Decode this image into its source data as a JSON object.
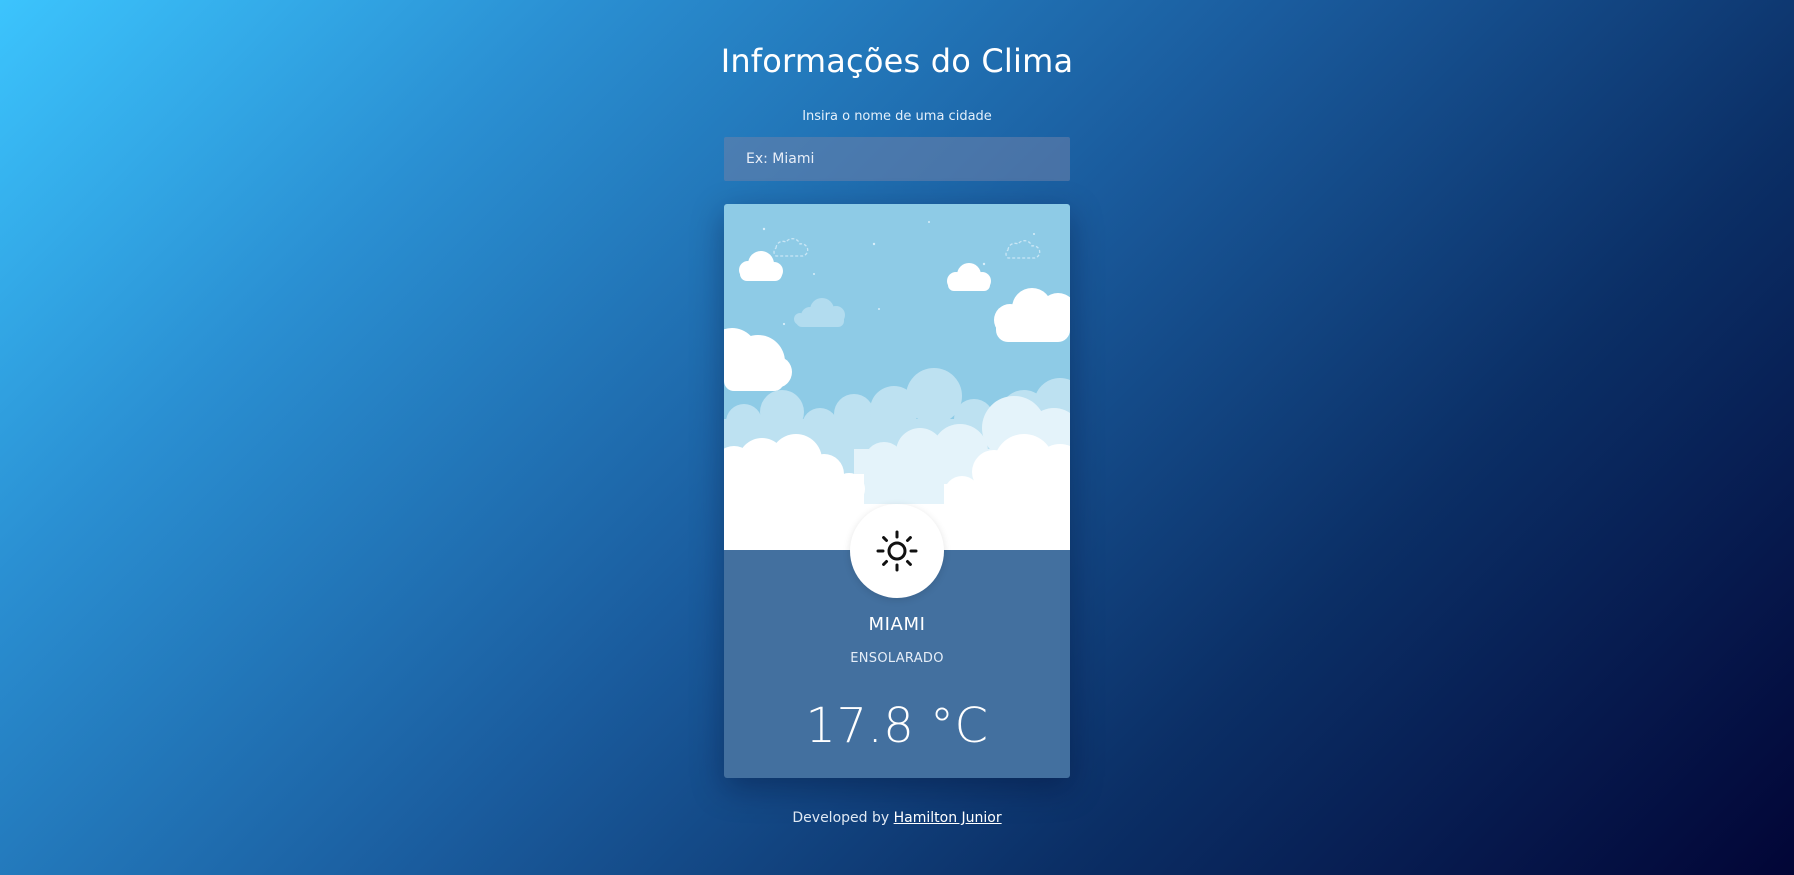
{
  "header": {
    "title": "Informações do Clima"
  },
  "search": {
    "label": "Insira o nome de uma cidade",
    "placeholder": "Ex: Miami",
    "value": ""
  },
  "weather": {
    "city": "MIAMI",
    "condition": "ENSOLARADO",
    "temperature": "17.8 °C",
    "icon": "sun-icon"
  },
  "footer": {
    "prefix": "Developed by",
    "author": "Hamilton Junior"
  },
  "colors": {
    "background_start": "#3cc4fd",
    "background_end": "#020536",
    "card": "#43709f",
    "sky": "#8ecbe6",
    "icon_badge": "#ffffff"
  }
}
